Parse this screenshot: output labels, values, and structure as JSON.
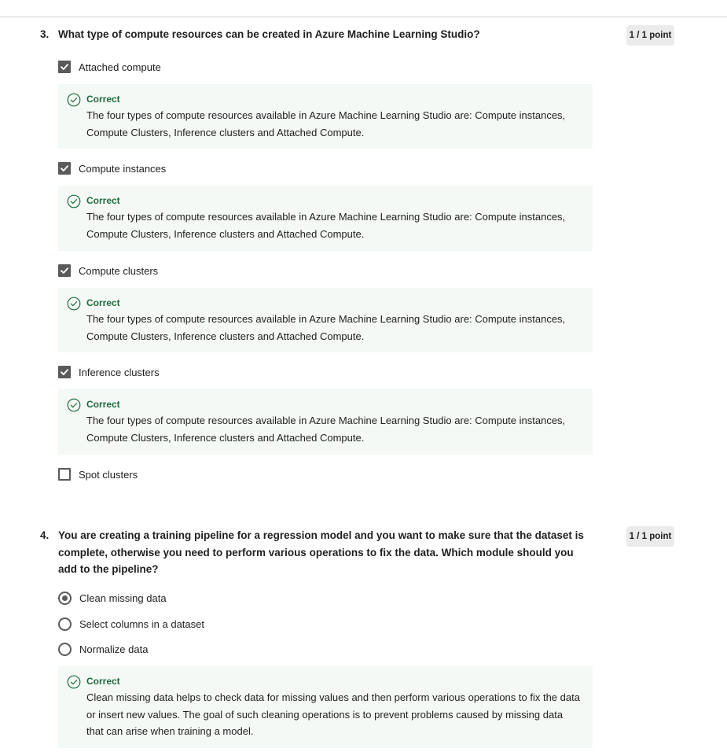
{
  "colors": {
    "correct": "#1d6b3e",
    "feedback_bg": "#f4f9f5",
    "control": "#5a5a5a",
    "points_bg": "#ebebeb"
  },
  "questions": [
    {
      "number": "3.",
      "text": "What type of compute resources can be created in Azure Machine Learning Studio?",
      "points": "1 / 1 point",
      "options": [
        {
          "label": "Attached compute",
          "selected": true,
          "control": "checkbox",
          "feedback_icon": "check-circle-icon",
          "feedback": {
            "title": "Correct",
            "text": "The four types of compute resources available in Azure Machine Learning Studio are: Compute instances, Compute Clusters, Inference clusters and Attached Compute."
          }
        },
        {
          "label": "Compute instances",
          "selected": true,
          "control": "checkbox",
          "feedback_icon": "check-circle-icon",
          "feedback": {
            "title": "Correct",
            "text": "The four types of compute resources available in Azure Machine Learning Studio are: Compute instances, Compute Clusters, Inference clusters and Attached Compute."
          }
        },
        {
          "label": "Compute clusters",
          "selected": true,
          "control": "checkbox",
          "feedback_icon": "check-circle-icon",
          "feedback": {
            "title": "Correct",
            "text": "The four types of compute resources available in Azure Machine Learning Studio are: Compute instances, Compute Clusters, Inference clusters and Attached Compute."
          }
        },
        {
          "label": "Inference clusters",
          "selected": true,
          "control": "checkbox",
          "feedback_icon": "check-circle-icon",
          "feedback": {
            "title": "Correct",
            "text": "The four types of compute resources available in Azure Machine Learning Studio are: Compute instances, Compute Clusters, Inference clusters and Attached Compute."
          }
        },
        {
          "label": "Spot clusters",
          "selected": false,
          "control": "checkbox"
        }
      ]
    },
    {
      "number": "4.",
      "text": "You are creating a training pipeline for a regression model and you want to make sure that the dataset is complete, otherwise you need to perform various operations to fix the data. Which module should you add to the pipeline?",
      "points": "1 / 1 point",
      "options": [
        {
          "label": "Clean missing data",
          "selected": true,
          "control": "radio"
        },
        {
          "label": "Select columns in a dataset",
          "selected": false,
          "control": "radio"
        },
        {
          "label": "Normalize data",
          "selected": false,
          "control": "radio"
        }
      ],
      "feedback_icon": "check-circle-icon",
      "feedback": {
        "title": "Correct",
        "text": "Clean missing data helps to check data for missing values and then perform various operations to fix the data or insert new values. The goal of such cleaning operations is to prevent problems caused by missing data that can arise when training a model."
      }
    }
  ]
}
